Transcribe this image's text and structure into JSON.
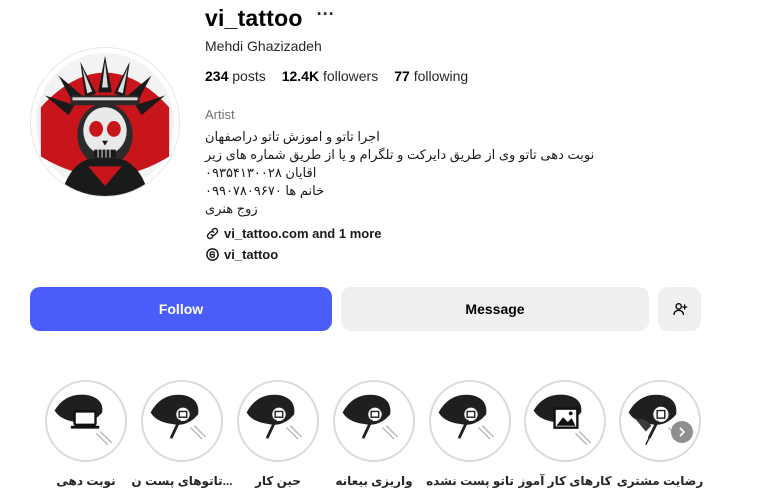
{
  "profile": {
    "username": "vi_tattoo",
    "more_options_icon": "more-horizontal-icon",
    "full_name": "Mehdi Ghazizadeh",
    "avatar_icon": "skull-headdress-avatar",
    "stats": {
      "posts_count": "234",
      "posts_label": "posts",
      "followers_count": "12.4K",
      "followers_label": "followers",
      "following_count": "77",
      "following_label": "following"
    },
    "category": "Artist",
    "bio_lines": [
      "اجرا تاتو و اموزش تاتو دراصفهان",
      "نوبت دهی تاتو وی از طریق دایرکت و تلگرام و یا از طریق شماره های زیر",
      "۰۹۳۵۴۱۳۰۰۲۸ اقایان",
      "۰۹۹۰۷۸۰۹۶۷۰ خانم ها",
      "زوج هنری"
    ],
    "link_text": "vi_tattoo.com and 1 more",
    "link_icon": "link-icon",
    "threads_handle": "vi_tattoo",
    "threads_icon": "threads-icon"
  },
  "actions": {
    "follow_label": "Follow",
    "message_label": "Message",
    "add_person_icon": "add-person-icon",
    "follow_color": "#4a5df9"
  },
  "highlights": {
    "items": [
      {
        "label": "رضایت مشتری",
        "icon": "tattoo-machine-icon"
      },
      {
        "label": "کارهای کار آموز",
        "icon": "picture-icon"
      },
      {
        "label": "تاتو پست نشده",
        "icon": "tattoo-machine-icon"
      },
      {
        "label": "واریزی بیعانه",
        "icon": "tattoo-machine-icon"
      },
      {
        "label": "حین کار",
        "icon": "tattoo-machine-icon"
      },
      {
        "label": "تاتوهای پست ن...",
        "icon": "tattoo-machine-icon"
      },
      {
        "label": "نوبت دهی",
        "icon": "laptop-icon"
      }
    ],
    "next_icon": "chevron-right-icon"
  }
}
